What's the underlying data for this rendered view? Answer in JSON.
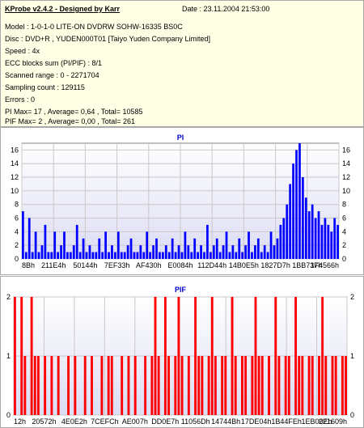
{
  "header": {
    "title": "KProbe v2.4.2 - Designed by Karr",
    "date": "Date : 23.11.2004 21:53:00",
    "lines": [
      "Model : 1-0-1-0 LITE-ON DVDRW SOHW-16335 BS0C",
      "Disc : DVD+R , YUDEN000T01 [Taiyo Yuden Company Limited]",
      "Speed : 4x",
      "ECC blocks sum (PI/PIF) : 8/1",
      "Scanned range : 0 - 2271704",
      "Sampling count : 129115",
      "Errors : 0",
      "PI Max= 17 , Average= 0,64 , Total= 10585",
      "PIF Max= 2 , Average= 0,00 , Total= 261"
    ]
  },
  "colors": {
    "pi_bars": "#0000ff",
    "pif_bars": "#ff0000",
    "title": "#0000cc",
    "grid": "#c8c8c8",
    "plot_bg_top": "#ffffff",
    "plot_bg_bottom": "#dcdcf4",
    "info_bg": "#ffffe6"
  },
  "chart_data": [
    {
      "type": "bar",
      "title": "PI",
      "ylim": [
        0,
        17
      ],
      "yticks": [
        0,
        2,
        4,
        6,
        8,
        10,
        12,
        14,
        16
      ],
      "x_tick_labels": [
        "8Bh",
        "211E4h",
        "50144h",
        "7EF33h",
        "AF430h",
        "E0084h",
        "112D44h",
        "14B0E5h",
        "1827D7h",
        "1BB737h",
        "1F4566h"
      ],
      "grid": true,
      "x": [
        0,
        1,
        2,
        3,
        4,
        5,
        6,
        7,
        8,
        9,
        10,
        11,
        12,
        13,
        14,
        15,
        16,
        17,
        18,
        19,
        20,
        21,
        22,
        23,
        24,
        25,
        26,
        27,
        28,
        29,
        30,
        31,
        32,
        33,
        34,
        35,
        36,
        37,
        38,
        39,
        40,
        41,
        42,
        43,
        44,
        45,
        46,
        47,
        48,
        49,
        50,
        51,
        52,
        53,
        54,
        55,
        56,
        57,
        58,
        59,
        60,
        61,
        62,
        63,
        64,
        65,
        66,
        67,
        68,
        69,
        70,
        71,
        72,
        73,
        74,
        75,
        76,
        77,
        78,
        79,
        80,
        81,
        82,
        83,
        84,
        85,
        86,
        87,
        88,
        89,
        90,
        91,
        92,
        93,
        94,
        95,
        96,
        97,
        98,
        99
      ],
      "values": [
        7,
        1,
        6,
        1,
        4,
        1,
        2,
        5,
        1,
        1,
        4,
        1,
        2,
        4,
        1,
        1,
        2,
        5,
        1,
        3,
        1,
        2,
        1,
        1,
        3,
        1,
        4,
        1,
        2,
        1,
        4,
        1,
        1,
        2,
        3,
        1,
        1,
        2,
        1,
        4,
        1,
        2,
        3,
        1,
        1,
        2,
        1,
        3,
        1,
        2,
        1,
        4,
        2,
        1,
        3,
        1,
        2,
        1,
        5,
        1,
        2,
        3,
        1,
        2,
        4,
        1,
        2,
        1,
        3,
        1,
        2,
        4,
        1,
        2,
        3,
        1,
        2,
        1,
        4,
        2,
        3,
        5,
        6,
        8,
        11,
        14,
        16,
        17,
        12,
        9,
        7,
        8,
        6,
        7,
        5,
        6,
        5,
        4,
        6,
        5
      ]
    },
    {
      "type": "bar",
      "title": "PIF",
      "ylim": [
        0,
        2
      ],
      "yticks": [
        0,
        1,
        2
      ],
      "x_tick_labels": [
        "12h",
        "20572h",
        "4E0E2h",
        "7CEFCh",
        "AE007h",
        "DD0E7h",
        "11056Dh",
        "14744Bh",
        "17DE04h",
        "1B44FEh",
        "1EB00Eh",
        "221609h"
      ],
      "grid": true,
      "x": [
        0,
        1,
        2,
        3,
        4,
        5,
        6,
        7,
        8,
        9,
        10,
        11,
        12,
        13,
        14,
        15,
        16,
        17,
        18,
        19,
        20,
        21,
        22,
        23,
        24,
        25,
        26,
        27,
        28,
        29,
        30,
        31,
        32,
        33,
        34,
        35,
        36,
        37,
        38,
        39,
        40,
        41,
        42,
        43,
        44,
        45,
        46,
        47,
        48,
        49,
        50,
        51,
        52,
        53,
        54,
        55,
        56,
        57,
        58,
        59,
        60,
        61,
        62,
        63,
        64,
        65,
        66,
        67,
        68,
        69,
        70,
        71,
        72,
        73,
        74,
        75,
        76,
        77,
        78,
        79,
        80,
        81,
        82,
        83,
        84,
        85,
        86,
        87,
        88,
        89,
        90,
        91,
        92,
        93,
        94,
        95,
        96,
        97,
        98,
        99
      ],
      "values": [
        2,
        0,
        2,
        1,
        0,
        2,
        1,
        1,
        0,
        1,
        0,
        1,
        0,
        1,
        0,
        0,
        1,
        0,
        1,
        0,
        0,
        1,
        0,
        1,
        0,
        0,
        1,
        0,
        1,
        1,
        0,
        0,
        1,
        0,
        1,
        0,
        1,
        0,
        0,
        1,
        0,
        1,
        2,
        1,
        0,
        2,
        1,
        0,
        1,
        2,
        1,
        0,
        1,
        0,
        2,
        1,
        1,
        0,
        1,
        2,
        1,
        0,
        1,
        1,
        0,
        2,
        1,
        0,
        1,
        1,
        0,
        1,
        2,
        1,
        1,
        0,
        1,
        0,
        2,
        1,
        0,
        1,
        1,
        0,
        2,
        1,
        1,
        0,
        1,
        1,
        0,
        1,
        2,
        1,
        0,
        1,
        1,
        0,
        1,
        1
      ]
    }
  ]
}
